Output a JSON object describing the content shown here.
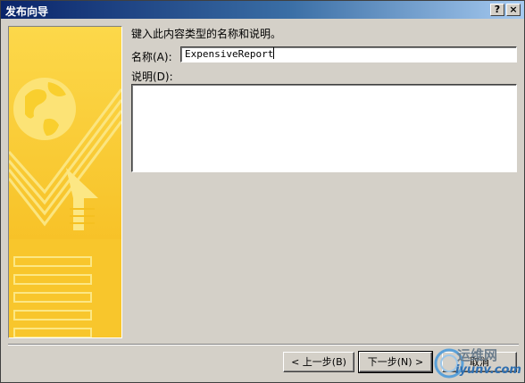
{
  "window": {
    "title": "发布向导",
    "help_button": "?",
    "close_button": "×"
  },
  "form": {
    "instruction": "键入此内容类型的名称和说明。",
    "name_label": "名称(A):",
    "name_value": "ExpensiveReport",
    "description_label": "说明(D):",
    "description_value": ""
  },
  "buttons": {
    "back": "< 上一步(B)",
    "next": "下一步(N) >",
    "cancel": "取消"
  },
  "watermark": {
    "text": "运维网",
    "url": "iyunv.com"
  },
  "colors": {
    "titlebar_start": "#0a246a",
    "titlebar_end": "#a6caf0",
    "dialog_face": "#d4d0c8",
    "art_yellow": "#f7c524",
    "art_light": "#fce784"
  }
}
